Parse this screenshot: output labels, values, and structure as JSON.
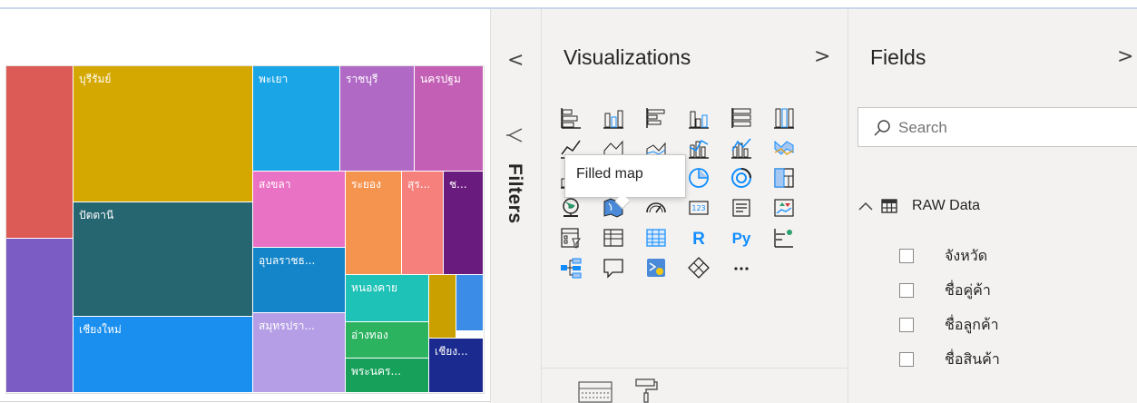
{
  "treemap": {
    "tiles": [
      {
        "label": "",
        "color": "#dd5b57"
      },
      {
        "label": "",
        "color": "#7b5cc4"
      },
      {
        "label": "บุรีรัมย์",
        "color": "#d4a800"
      },
      {
        "label": "ปัตตานี",
        "color": "#256670"
      },
      {
        "label": "เชียงใหม่",
        "color": "#1a8ff0"
      },
      {
        "label": "พะเยา",
        "color": "#1aa6e6"
      },
      {
        "label": "ราชบุรี",
        "color": "#b06ac6"
      },
      {
        "label": "นครปฐม",
        "color": "#c45fb6"
      },
      {
        "label": "สงขลา",
        "color": "#ea72c4"
      },
      {
        "label": "ระยอง",
        "color": "#f5944f"
      },
      {
        "label": "สุร...",
        "color": "#f5807c"
      },
      {
        "label": "ช...",
        "color": "#6a1b7e"
      },
      {
        "label": "อุบลราชธ...",
        "color": "#1485c9"
      },
      {
        "label": "สมุทรปรา...",
        "color": "#b59ee6"
      },
      {
        "label": "หนองคาย",
        "color": "#1fc2b7"
      },
      {
        "label": "",
        "color": "#c9a000"
      },
      {
        "label": "",
        "color": "#3a8ce6"
      },
      {
        "label": "อ่างทอง",
        "color": "#2cb360"
      },
      {
        "label": "พระนคร...",
        "color": "#17a05a"
      },
      {
        "label": "เชียง...",
        "color": "#1b2a8f"
      }
    ]
  },
  "filters": {
    "label": "Filters"
  },
  "visualizations": {
    "title": "Visualizations",
    "tooltip": "Filled map",
    "icons": [
      "stacked-bar-chart-icon",
      "stacked-column-chart-icon",
      "clustered-bar-chart-icon",
      "clustered-column-chart-icon",
      "100-stacked-bar-chart-icon",
      "100-stacked-column-chart-icon",
      "line-chart-icon",
      "area-chart-icon",
      "stacked-area-chart-icon",
      "line-and-stacked-column-chart-icon",
      "line-and-clustered-column-chart-icon",
      "ribbon-chart-icon",
      "waterfall-chart-icon",
      "funnel-icon",
      "scatter-chart-icon",
      "pie-chart-icon",
      "donut-chart-icon",
      "treemap-icon",
      "map-icon",
      "filled-map-icon",
      "gauge-icon",
      "card-icon",
      "multi-row-card-icon",
      "kpi-icon",
      "slicer-icon",
      "table-icon",
      "matrix-icon",
      "r-script-visual-icon",
      "python-visual-icon",
      "key-influencers-icon",
      "decomposition-tree-icon",
      "qa-icon",
      "smart-narrative-icon",
      "power-apps-icon",
      "more-visuals-icon"
    ],
    "r_label": "R",
    "py_label": "Py",
    "more_label": "···"
  },
  "fields": {
    "title": "Fields",
    "search_placeholder": "Search",
    "table_name": "RAW Data",
    "items": [
      "จังหวัด",
      "ชื่อคู่ค้า",
      "ชื่อลูกค้า",
      "ชื่อสินค้า"
    ]
  },
  "colors": {
    "pane_bg": "#f3f2f1",
    "accent": "#f2c811",
    "icon_blue": "#118dff",
    "icon_dark": "#252423"
  }
}
